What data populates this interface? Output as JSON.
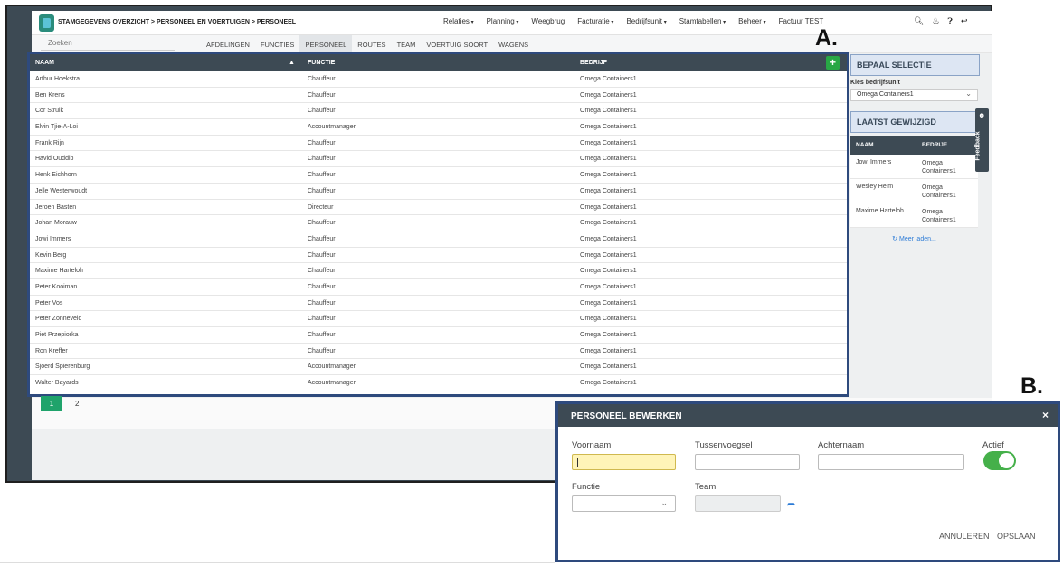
{
  "labels": {
    "a": "A.",
    "b": "B."
  },
  "header": {
    "breadcrumb": "STAMGEGEVENS OVERZICHT > PERSONEEL EN VOERTUIGEN > PERSONEEL",
    "nav": [
      "Relaties",
      "Planning",
      "Weegbrug",
      "Facturatie",
      "Bedrijfsunit",
      "Stamtabellen",
      "Beheer",
      "Factuur TEST"
    ],
    "icons": [
      "search-icon",
      "bell-icon",
      "help-icon",
      "logout-icon"
    ]
  },
  "subbar": {
    "search_placeholder": "Zoeken",
    "tabs": [
      "AFDELINGEN",
      "FUNCTIES",
      "PERSONEEL",
      "ROUTES",
      "TEAM",
      "VOERTUIG SOORT",
      "WAGENS"
    ],
    "active_tab": "PERSONEEL"
  },
  "table": {
    "headers": {
      "naam": "NAAM",
      "functie": "FUNCTIE",
      "bedrijf": "BEDRIJF"
    },
    "add_label": "+",
    "rows": [
      [
        "Arthur Hoekstra",
        "Chauffeur",
        "Omega Containers1"
      ],
      [
        "Ben Krens",
        "Chauffeur",
        "Omega Containers1"
      ],
      [
        "Cor Struik",
        "Chauffeur",
        "Omega Containers1"
      ],
      [
        "Elvin Tjie-A-Loi",
        "Accountmanager",
        "Omega Containers1"
      ],
      [
        "Frank Rijn",
        "Chauffeur",
        "Omega Containers1"
      ],
      [
        "Havid Ouddib",
        "Chauffeur",
        "Omega Containers1"
      ],
      [
        "Henk Eichhorn",
        "Chauffeur",
        "Omega Containers1"
      ],
      [
        "Jelle Westerwoudt",
        "Chauffeur",
        "Omega Containers1"
      ],
      [
        "Jeroen Basten",
        "Directeur",
        "Omega Containers1"
      ],
      [
        "Johan Morauw",
        "Chauffeur",
        "Omega Containers1"
      ],
      [
        "Jowi Immers",
        "Chauffeur",
        "Omega Containers1"
      ],
      [
        "Kevin Berg",
        "Chauffeur",
        "Omega Containers1"
      ],
      [
        "Maxime Harteloh",
        "Chauffeur",
        "Omega Containers1"
      ],
      [
        "Peter Kooiman",
        "Chauffeur",
        "Omega Containers1"
      ],
      [
        "Peter Vos",
        "Chauffeur",
        "Omega Containers1"
      ],
      [
        "Peter Zonneveld",
        "Chauffeur",
        "Omega Containers1"
      ],
      [
        "Piet Przepiorka",
        "Chauffeur",
        "Omega Containers1"
      ],
      [
        "Ron Kreffer",
        "Chauffeur",
        "Omega Containers1"
      ],
      [
        "Sjoerd Spierenburg",
        "Accountmanager",
        "Omega Containers1"
      ],
      [
        "Walter Bayards",
        "Accountmanager",
        "Omega Containers1"
      ]
    ]
  },
  "pager": {
    "pages": [
      "1",
      "2"
    ],
    "active": "1"
  },
  "sidebar": {
    "selectie_title": "BEPAAL SELECTIE",
    "kies_label": "Kies bedrijfsunit",
    "bedrijfsunit_value": "Omega Containers1",
    "gewijzigd_title": "LAATST GEWIJZIGD",
    "headers": {
      "naam": "NAAM",
      "bedrijf": "BEDRIJF"
    },
    "rows": [
      [
        "Jowi Immers",
        "Omega Containers1"
      ],
      [
        "Wesley Helm",
        "Omega Containers1"
      ],
      [
        "Maxime Harteloh",
        "Omega Containers1"
      ]
    ],
    "meer_label": "Meer laden..."
  },
  "feedback": {
    "label": "Feedback"
  },
  "dialog": {
    "title": "PERSONEEL BEWERKEN",
    "close": "×",
    "voornaam_label": "Voornaam",
    "voornaam_value": "",
    "tussenvoegsel_label": "Tussenvoegsel",
    "tussenvoegsel_value": "",
    "achternaam_label": "Achternaam",
    "achternaam_value": "",
    "actief_label": "Actief",
    "actief": true,
    "functie_label": "Functie",
    "functie_value": "",
    "team_label": "Team",
    "team_value": "",
    "annuleren": "ANNULEREN",
    "opslaan": "OPSLAAN"
  }
}
